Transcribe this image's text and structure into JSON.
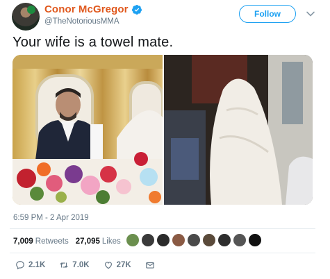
{
  "user": {
    "display_name": "Conor McGregor",
    "handle": "@TheNotoriousMMA",
    "verified": true,
    "name_color": "#e0581d"
  },
  "follow_button": {
    "label": "Follow",
    "color": "#1da1f2"
  },
  "tweet": {
    "text": "Your wife is a towel mate.",
    "timestamp": "6:59 PM - 2 Apr 2019"
  },
  "media": {
    "images": [
      {
        "icon": "photo-man-seated-wedding-table"
      },
      {
        "icon": "photo-veiled-bride"
      }
    ]
  },
  "stats": {
    "retweets_count": "7,009",
    "retweets_label": "Retweets",
    "likes_count": "27,095",
    "likes_label": "Likes",
    "liker_avatar_colors": [
      "#6b8f4e",
      "#3a3a3a",
      "#2b2b2b",
      "#8a5a44",
      "#4a4a4a",
      "#5a4a3a",
      "#2e2e2e",
      "#555555",
      "#111111"
    ]
  },
  "actions": {
    "reply_count": "2.1K",
    "retweet_count": "7.0K",
    "like_count": "27K"
  }
}
